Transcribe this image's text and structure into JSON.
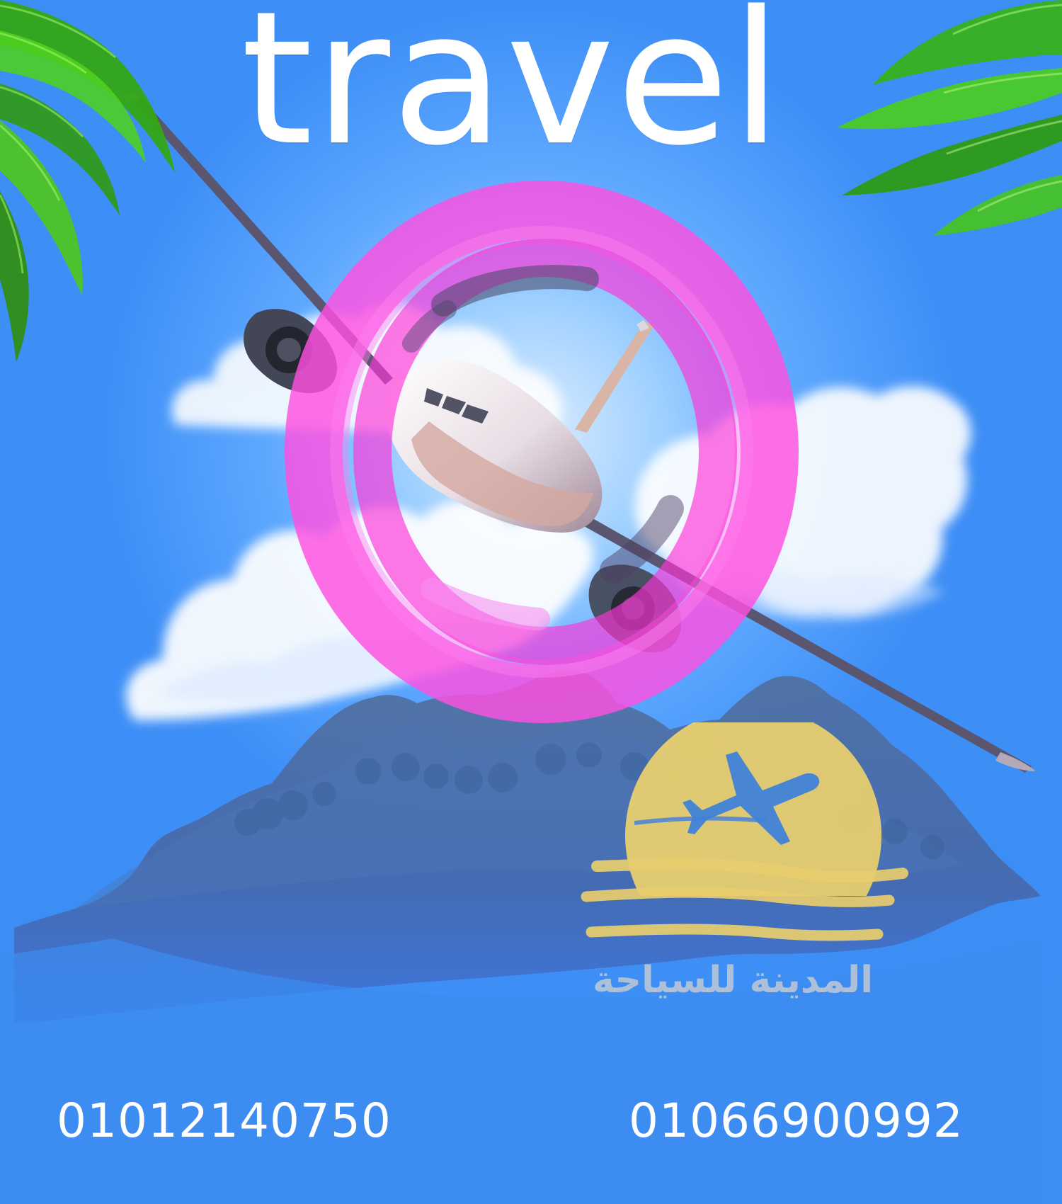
{
  "page": {
    "title": "travel",
    "brand_text": "المدينة للسياحة",
    "phones": [
      "01012140750",
      "01066900992"
    ]
  },
  "visuals": {
    "background": "sky",
    "clouds": "white-clouds",
    "island": "mountain-island",
    "airplane": "airplane",
    "portal_ring": "pink-ring",
    "logo_symbol": "sun-wave-airplane-logo",
    "palm_left": "palm-leaves",
    "palm_right": "palm-leaves"
  },
  "colors": {
    "sky": "#3d8df2",
    "sky_glow": "#dcedff",
    "ring": "#ff3ed8",
    "logo_sun": "#e7ce6d",
    "logo_plane": "#3f82d8",
    "logo_text": "#c4ccd3",
    "leaf": "#46c51f",
    "island": "#4d6ba5"
  }
}
